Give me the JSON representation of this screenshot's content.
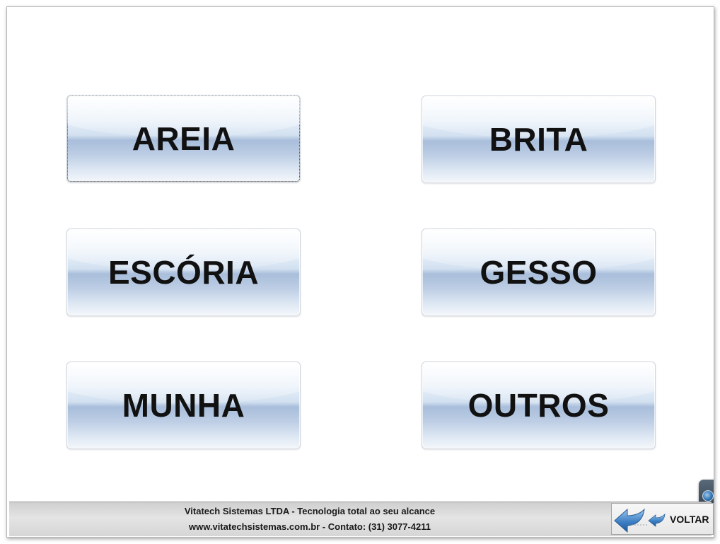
{
  "buttons": {
    "areia": "AREIA",
    "brita": "BRITA",
    "escoria": "ESCÓRIA",
    "gesso": "GESSO",
    "munha": "MUNHA",
    "outros": "OUTROS"
  },
  "footer": {
    "line1": "Vitatech Sistemas LTDA - Tecnologia total ao seu alcance",
    "line2": "www.vitatechsistemas.com.br - Contato: (31) 3077-4211",
    "voltar_label": "VOLTAR"
  },
  "icons": {
    "back": "double-back-arrow-icon",
    "side_tab": "teamviewer-tab-icon"
  },
  "colors": {
    "button_blue": "#a9bedb",
    "footer_gray": "#d6d6d6",
    "arrow_blue": "#3d7fc4"
  }
}
